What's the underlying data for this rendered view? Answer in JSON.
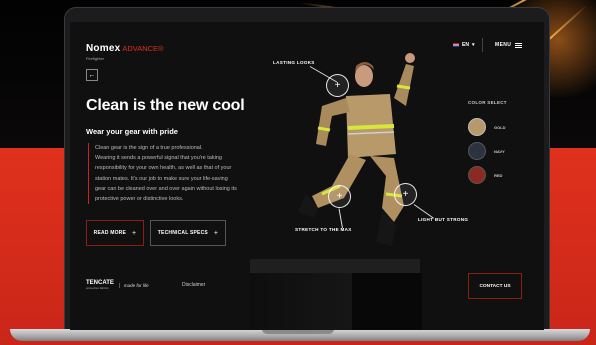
{
  "site": {
    "logo_main": "Nomex",
    "logo_x": "x",
    "logo_advance": "ADVANCE®",
    "logo_sub": "Firefighter",
    "language": "EN",
    "language_caret": "▾",
    "menu_label": "MENU"
  },
  "hero": {
    "back_icon": "←",
    "title": "Clean is the new cool",
    "subtitle": "Wear your gear with pride",
    "body_lines": [
      "Clean gear is the sign of a true professional.",
      "Wearing it sends a powerful signal that you're taking",
      "responsibility for your own health, as well as that of your",
      "station mates. It's our job to make sure your life-saving",
      "gear can be cleaned over and over again without losing its",
      "protective power or distinctive looks."
    ]
  },
  "buttons": {
    "read_more": "READ MORE",
    "tech_specs": "TECHNICAL SPECS",
    "plus": "+",
    "contact": "CONTACT US"
  },
  "hotspots": {
    "lasting_looks": "LASTING LOOKS",
    "light_but_strong": "LIGHT BUT STRONG",
    "stretch": "STRETCH TO THE MAX",
    "plus": "+"
  },
  "color_select": {
    "title": "COLOR SELECT",
    "options": [
      {
        "label": "GOLD",
        "color": "#b89a6a"
      },
      {
        "label": "NAVY",
        "color": "#2c3340"
      },
      {
        "label": "RED",
        "color": "#8a2a22"
      }
    ]
  },
  "footer": {
    "brand": "TENCATE",
    "brand_sub": "protective fabrics",
    "made_for_life": "made for life",
    "disclaimer": "Disclaimer"
  },
  "colors": {
    "accent_red": "#e0311c",
    "suit_tan": "#b89a6a",
    "reflective": "#d7e63a"
  }
}
